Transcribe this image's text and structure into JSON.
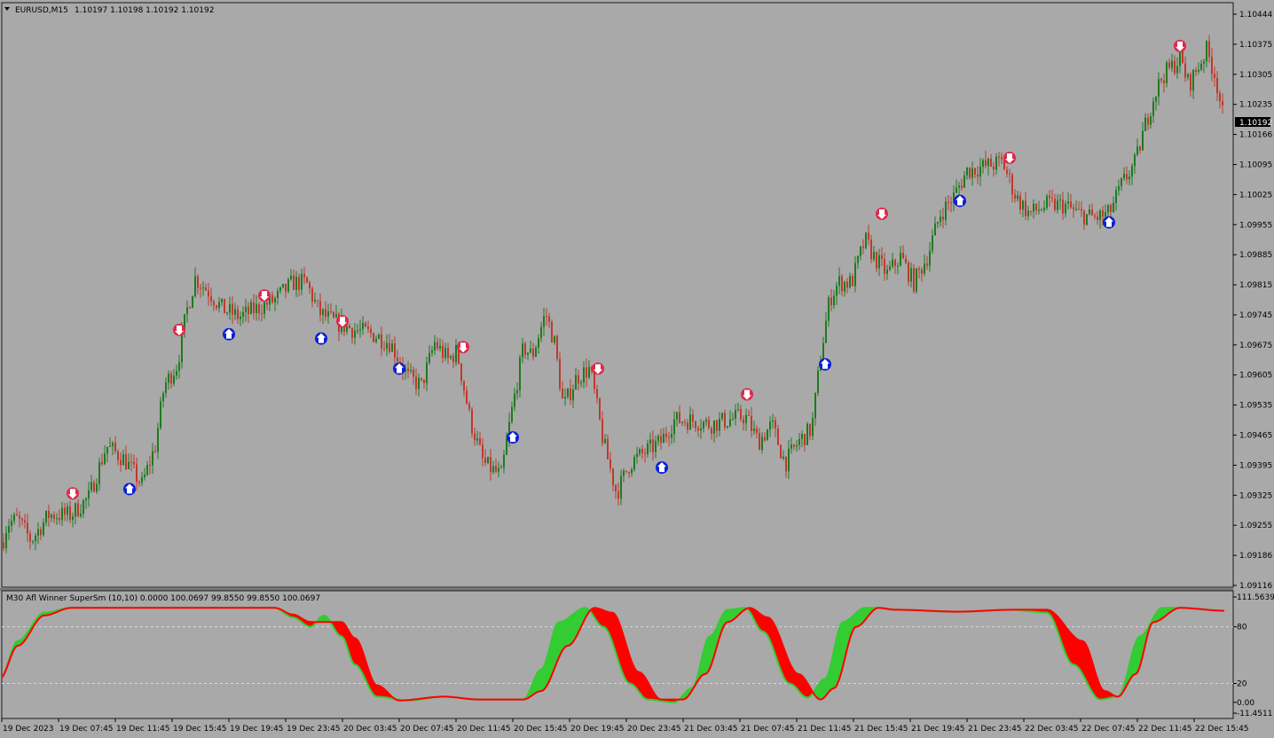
{
  "header": {
    "symbol_timeframe": "EURUSD,M15",
    "ohlc": "1.10197 1.10198 1.10192 1.10192"
  },
  "indicator": {
    "label": "M30 Afl Winner SuperSm (10,10) 0.0000 100.0697 99.8550 99.8550 100.0697"
  },
  "colors": {
    "background": "#a9a9a9",
    "bull_candle": "#1f7a1f",
    "bear_candle": "#c0392b",
    "signal_down": "#e0284a",
    "signal_up": "#0a1fd6",
    "indicator_green": "#33cc33",
    "indicator_red": "#ff0000"
  },
  "price_axis": {
    "labels": [
      "1.10444",
      "1.10375",
      "1.10305",
      "1.10235",
      "1.10166",
      "1.10095",
      "1.10025",
      "1.09955",
      "1.09885",
      "1.09815",
      "1.09745",
      "1.09675",
      "1.09605",
      "1.09535",
      "1.09465",
      "1.09395",
      "1.09325",
      "1.09255",
      "1.09186",
      "1.09116"
    ],
    "current_price": "1.10192"
  },
  "indicator_axis": {
    "labels": [
      "111.5639",
      "80",
      "20",
      "0.00",
      "-11.4511"
    ]
  },
  "time_axis": {
    "labels": [
      "19 Dec 2023",
      "19 Dec 07:45",
      "19 Dec 11:45",
      "19 Dec 15:45",
      "19 Dec 19:45",
      "19 Dec 23:45",
      "20 Dec 03:45",
      "20 Dec 07:45",
      "20 Dec 11:45",
      "20 Dec 15:45",
      "20 Dec 19:45",
      "20 Dec 23:45",
      "21 Dec 03:45",
      "21 Dec 07:45",
      "21 Dec 11:45",
      "21 Dec 15:45",
      "21 Dec 19:45",
      "21 Dec 23:45",
      "22 Dec 03:45",
      "22 Dec 07:45",
      "22 Dec 11:45",
      "22 Dec 15:45"
    ]
  },
  "chart_data": {
    "type": "candlestick",
    "symbol": "EURUSD",
    "timeframe": "M15",
    "ylim": [
      1.09116,
      1.10444
    ],
    "path": [
      [
        0,
        1.0919
      ],
      [
        8,
        1.0926
      ],
      [
        20,
        1.0927
      ],
      [
        35,
        1.0922
      ],
      [
        55,
        1.0928
      ],
      [
        80,
        1.0928
      ],
      [
        100,
        1.0932
      ],
      [
        120,
        1.0944
      ],
      [
        140,
        1.0941
      ],
      [
        160,
        1.0935
      ],
      [
        175,
        1.0944
      ],
      [
        185,
        1.0958
      ],
      [
        200,
        1.0963
      ],
      [
        210,
        1.0975
      ],
      [
        220,
        1.0983
      ],
      [
        235,
        1.098
      ],
      [
        250,
        1.0976
      ],
      [
        270,
        1.0974
      ],
      [
        290,
        1.0976
      ],
      [
        310,
        1.0978
      ],
      [
        330,
        1.0982
      ],
      [
        345,
        1.0982
      ],
      [
        360,
        1.0975
      ],
      [
        375,
        1.0973
      ],
      [
        400,
        1.0971
      ],
      [
        420,
        1.097
      ],
      [
        440,
        1.0968
      ],
      [
        460,
        1.096
      ],
      [
        475,
        1.0958
      ],
      [
        490,
        1.0968
      ],
      [
        505,
        1.0964
      ],
      [
        515,
        1.0966
      ],
      [
        530,
        1.095
      ],
      [
        545,
        1.094
      ],
      [
        565,
        1.0937
      ],
      [
        575,
        1.095
      ],
      [
        590,
        1.0967
      ],
      [
        600,
        1.0965
      ],
      [
        615,
        1.0975
      ],
      [
        625,
        1.0968
      ],
      [
        635,
        1.0953
      ],
      [
        650,
        1.096
      ],
      [
        665,
        1.0962
      ],
      [
        680,
        1.0945
      ],
      [
        695,
        1.0933
      ],
      [
        710,
        1.094
      ],
      [
        730,
        1.0943
      ],
      [
        745,
        1.0945
      ],
      [
        760,
        1.095
      ],
      [
        780,
        1.095
      ],
      [
        800,
        1.0949
      ],
      [
        820,
        1.095
      ],
      [
        840,
        1.0951
      ],
      [
        855,
        1.0945
      ],
      [
        870,
        1.0949
      ],
      [
        885,
        1.094
      ],
      [
        900,
        1.0945
      ],
      [
        915,
        1.0948
      ],
      [
        925,
        1.0965
      ],
      [
        935,
        1.0978
      ],
      [
        945,
        1.0982
      ],
      [
        960,
        1.0982
      ],
      [
        975,
        1.0992
      ],
      [
        985,
        1.0988
      ],
      [
        1000,
        1.0984
      ],
      [
        1015,
        1.0988
      ],
      [
        1030,
        1.0982
      ],
      [
        1045,
        1.0988
      ],
      [
        1060,
        1.0998
      ],
      [
        1075,
        1.1002
      ],
      [
        1090,
        1.1008
      ],
      [
        1110,
        1.1009
      ],
      [
        1130,
        1.101
      ],
      [
        1145,
        1.1002
      ],
      [
        1160,
        1.0998
      ],
      [
        1180,
        1.1
      ],
      [
        1200,
        1.1
      ],
      [
        1215,
        1.0998
      ],
      [
        1235,
        1.0997
      ],
      [
        1250,
        1.0998
      ],
      [
        1265,
        1.1005
      ],
      [
        1280,
        1.101
      ],
      [
        1290,
        1.1018
      ],
      [
        1300,
        1.1025
      ],
      [
        1310,
        1.103
      ],
      [
        1320,
        1.1032
      ],
      [
        1330,
        1.1034
      ],
      [
        1340,
        1.1028
      ],
      [
        1350,
        1.1032
      ],
      [
        1360,
        1.1036
      ],
      [
        1370,
        1.103
      ],
      [
        1380,
        1.1019
      ]
    ],
    "signals_up": [
      [
        146,
        1.0934
      ],
      [
        258,
        1.097
      ],
      [
        362,
        1.0969
      ],
      [
        450,
        1.0962
      ],
      [
        578,
        1.0946
      ],
      [
        746,
        1.0939
      ],
      [
        930,
        1.0963
      ],
      [
        1082,
        1.1001
      ],
      [
        1250,
        1.0996
      ]
    ],
    "signals_down": [
      [
        82,
        1.0933
      ],
      [
        202,
        1.0971
      ],
      [
        298,
        1.0979
      ],
      [
        386,
        1.0973
      ],
      [
        522,
        1.0967
      ],
      [
        674,
        1.0962
      ],
      [
        842,
        1.0956
      ],
      [
        994,
        1.0998
      ],
      [
        1138,
        1.1011
      ],
      [
        1330,
        1.1037
      ]
    ],
    "indicator": {
      "type": "line",
      "ylim": [
        -11.4511,
        111.5639
      ],
      "levels": [
        80,
        20
      ],
      "series": [
        {
          "values": [
            [
              0,
              25
            ],
            [
              20,
              65
            ],
            [
              50,
              95
            ],
            [
              80,
              100
            ],
            [
              200,
              100
            ],
            [
              310,
              100
            ],
            [
              330,
              90
            ],
            [
              350,
              80
            ],
            [
              365,
              92
            ],
            [
              385,
              70
            ],
            [
              400,
              40
            ],
            [
              425,
              6
            ],
            [
              460,
              2
            ],
            [
              500,
              6
            ],
            [
              540,
              3
            ],
            [
              590,
              3
            ],
            [
              610,
              35
            ],
            [
              630,
              85
            ],
            [
              660,
              100
            ],
            [
              680,
              80
            ],
            [
              710,
              20
            ],
            [
              730,
              3
            ],
            [
              760,
              0
            ],
            [
              780,
              15
            ],
            [
              800,
              70
            ],
            [
              820,
              98
            ],
            [
              840,
              100
            ],
            [
              860,
              75
            ],
            [
              890,
              20
            ],
            [
              910,
              5
            ],
            [
              930,
              25
            ],
            [
              950,
              85
            ],
            [
              975,
              100
            ],
            [
              990,
              100
            ],
            [
              1010,
              98
            ],
            [
              1080,
              96
            ],
            [
              1140,
              98
            ],
            [
              1180,
              95
            ],
            [
              1210,
              40
            ],
            [
              1240,
              3
            ],
            [
              1260,
              6
            ],
            [
              1285,
              70
            ],
            [
              1310,
              100
            ],
            [
              1330,
              100
            ],
            [
              1380,
              97
            ]
          ]
        },
        {
          "values": [
            [
              0,
              25
            ],
            [
              20,
              60
            ],
            [
              50,
              92
            ],
            [
              80,
              100
            ],
            [
              200,
              100
            ],
            [
              310,
              100
            ],
            [
              330,
              93
            ],
            [
              350,
              85
            ],
            [
              365,
              85
            ],
            [
              385,
              85
            ],
            [
              400,
              68
            ],
            [
              425,
              18
            ],
            [
              450,
              2
            ],
            [
              500,
              6
            ],
            [
              540,
              3
            ],
            [
              590,
              3
            ],
            [
              610,
              12
            ],
            [
              640,
              60
            ],
            [
              670,
              100
            ],
            [
              690,
              95
            ],
            [
              720,
              32
            ],
            [
              745,
              3
            ],
            [
              770,
              3
            ],
            [
              795,
              30
            ],
            [
              820,
              85
            ],
            [
              845,
              100
            ],
            [
              865,
              90
            ],
            [
              900,
              30
            ],
            [
              925,
              3
            ],
            [
              940,
              15
            ],
            [
              965,
              80
            ],
            [
              990,
              100
            ],
            [
              1010,
              98
            ],
            [
              1080,
              96
            ],
            [
              1140,
              98
            ],
            [
              1180,
              98
            ],
            [
              1220,
              65
            ],
            [
              1245,
              12
            ],
            [
              1260,
              6
            ],
            [
              1280,
              30
            ],
            [
              1300,
              85
            ],
            [
              1330,
              100
            ],
            [
              1380,
              97
            ]
          ]
        }
      ]
    }
  }
}
